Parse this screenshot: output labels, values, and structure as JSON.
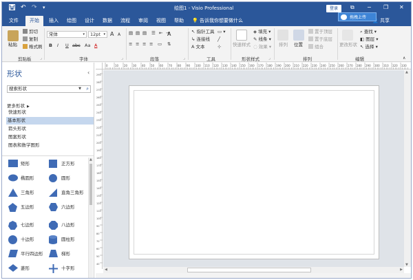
{
  "window": {
    "title": "绘图1 - Visio Professional",
    "login_label": "登录",
    "upload_label": "拖拽上传",
    "share_label": "共享",
    "tell_me": "告诉我你想要做什么",
    "qa_save_icon": "save-icon",
    "qa_undo_icon": "undo-icon",
    "qa_redo_icon": "redo-icon"
  },
  "menu": {
    "tabs": [
      "文件",
      "开始",
      "插入",
      "绘图",
      "设计",
      "数据",
      "流程",
      "审阅",
      "视图",
      "帮助"
    ],
    "active": "开始"
  },
  "ribbon": {
    "clipboard": {
      "paste": "粘贴",
      "cut": "剪切",
      "copy": "复制",
      "format_painter": "格式刷",
      "label": "剪贴板"
    },
    "font": {
      "family": "宋体",
      "size": "12pt",
      "bold": "B",
      "italic": "I",
      "underline": "U",
      "strike": "abc",
      "case": "Aa",
      "color": "A",
      "grow": "A",
      "shrink": "A",
      "label": "字体"
    },
    "paragraph": {
      "label": "段落",
      "bullet": "A"
    },
    "tools": {
      "pointer": "指针工具",
      "connector": "连接线",
      "text": "文本",
      "label": "工具"
    },
    "shape_styles": {
      "quick_styles": "快速样式",
      "fill": "填充",
      "line": "线条",
      "effects": "效果",
      "label": "形状样式"
    },
    "arrange": {
      "align": "排列",
      "position": "位置",
      "bring_front": "置于顶层",
      "send_back": "置于底层",
      "group": "组合",
      "label": "排列"
    },
    "editing": {
      "change_shape": "更改形状",
      "find": "查找",
      "layers": "图层",
      "select": "选择",
      "label": "编辑"
    }
  },
  "shapes_pane": {
    "title": "形状",
    "search_placeholder": "搜索形状",
    "more_shapes": "更多形状",
    "stencils": [
      "快速形状",
      "基本形状",
      "箭头形状",
      "图案形状",
      "图表和数学图形"
    ],
    "selected_stencil": "基本形状",
    "items": [
      [
        "矩形",
        "正方形"
      ],
      [
        "椭圆形",
        "圆形"
      ],
      [
        "三角形",
        "直角三角形"
      ],
      [
        "五边形",
        "六边形"
      ],
      [
        "七边形",
        "八边形"
      ],
      [
        "十边形",
        "圆柱形"
      ],
      [
        "平行四边形",
        "梯形"
      ],
      [
        "菱形",
        "十字形"
      ]
    ]
  },
  "ruler": {
    "h_marks": [
      "0",
      "10",
      "20",
      "30",
      "40",
      "50",
      "60",
      "70",
      "80",
      "90",
      "100",
      "110",
      "120",
      "130",
      "140",
      "150",
      "160",
      "170",
      "180",
      "190",
      "200",
      "210",
      "220",
      "230",
      "240",
      "250",
      "260",
      "270",
      "280",
      "290",
      "300",
      "310",
      "320",
      "330"
    ],
    "v_marks": [
      "290",
      "280",
      "270",
      "260",
      "250",
      "240",
      "230",
      "220",
      "210",
      "200",
      "190",
      "180",
      "170",
      "160",
      "150",
      "140",
      "130",
      "120",
      "110",
      "100",
      "90",
      "80",
      "70",
      "60",
      "50",
      "40"
    ]
  },
  "colors": {
    "accent": "#2b579a",
    "shape_fill": "#3f6bb5",
    "selected": "#c5d7ee"
  }
}
